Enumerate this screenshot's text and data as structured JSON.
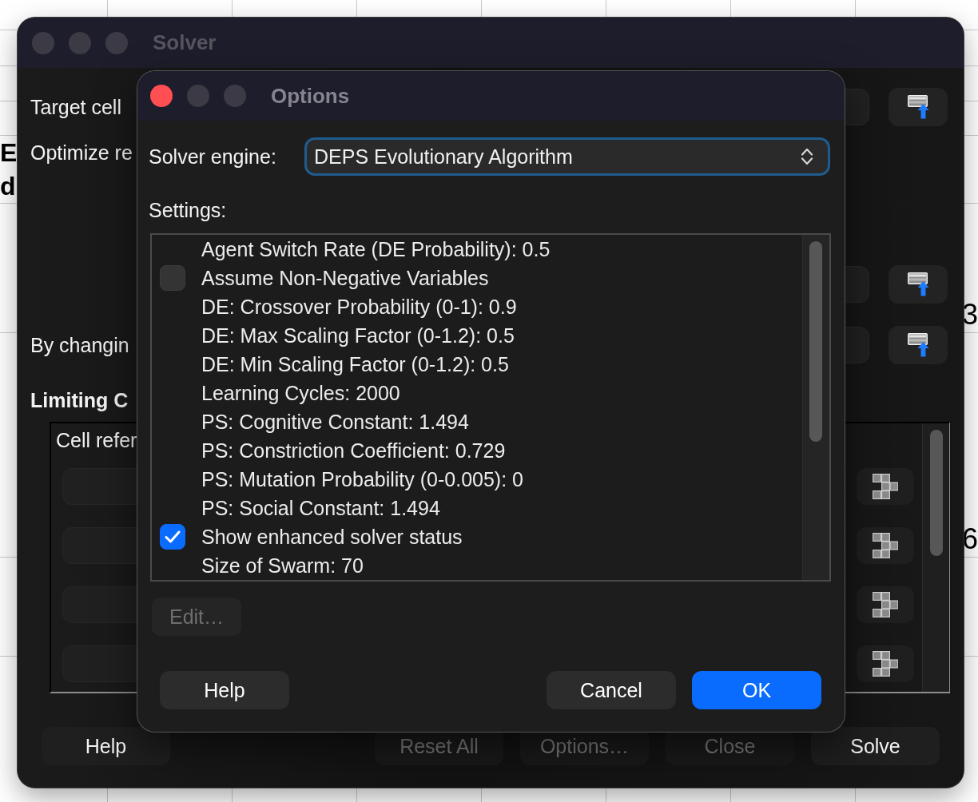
{
  "spreadsheet": {
    "left_cells": [
      "E",
      "d"
    ],
    "right_cells": [
      "3",
      "6"
    ]
  },
  "solver_window": {
    "title": "Solver",
    "active": false,
    "target_label": "Target cell",
    "optimize_label": "Optimize re",
    "changing_label": "By changin",
    "constraints_heading": "Limiting C",
    "constraints_column": "Cell refer",
    "help_button": {
      "label": "Help",
      "disabled": false
    },
    "buttons": [
      {
        "label": "Reset All",
        "disabled": true
      },
      {
        "label": "Options…",
        "disabled": true
      },
      {
        "label": "Close",
        "disabled": true
      },
      {
        "label": "Solve",
        "disabled": false
      }
    ]
  },
  "options_dialog": {
    "title": "Options",
    "active": true,
    "engine_label": "Solver engine:",
    "engine": "DEPS Evolutionary Algorithm",
    "settings_label": "Settings:",
    "settings": [
      {
        "kind": "value",
        "label": "Agent Switch Rate (DE Probability): 0.5"
      },
      {
        "kind": "checkbox",
        "label": "Assume Non-Negative Variables",
        "checked": false
      },
      {
        "kind": "value",
        "label": "DE: Crossover Probability (0-1): 0.9"
      },
      {
        "kind": "value",
        "label": "DE: Max Scaling Factor (0-1.2): 0.5"
      },
      {
        "kind": "value",
        "label": "DE: Min Scaling Factor (0-1.2): 0.5"
      },
      {
        "kind": "value",
        "label": "Learning Cycles: 2000"
      },
      {
        "kind": "value",
        "label": "PS: Cognitive Constant: 1.494"
      },
      {
        "kind": "value",
        "label": "PS: Constriction Coefficient: 0.729"
      },
      {
        "kind": "value",
        "label": "PS: Mutation Probability (0-0.005): 0"
      },
      {
        "kind": "value",
        "label": "PS: Social Constant: 1.494"
      },
      {
        "kind": "checkbox",
        "label": "Show enhanced solver status",
        "checked": true
      },
      {
        "kind": "value",
        "label": "Size of Swarm: 70"
      }
    ],
    "edit_button": {
      "label": "Edit…",
      "disabled": true
    },
    "help_button": {
      "label": "Help",
      "default": false
    },
    "buttons": [
      {
        "label": "Cancel",
        "default": false
      },
      {
        "label": "OK",
        "default": true
      }
    ]
  }
}
